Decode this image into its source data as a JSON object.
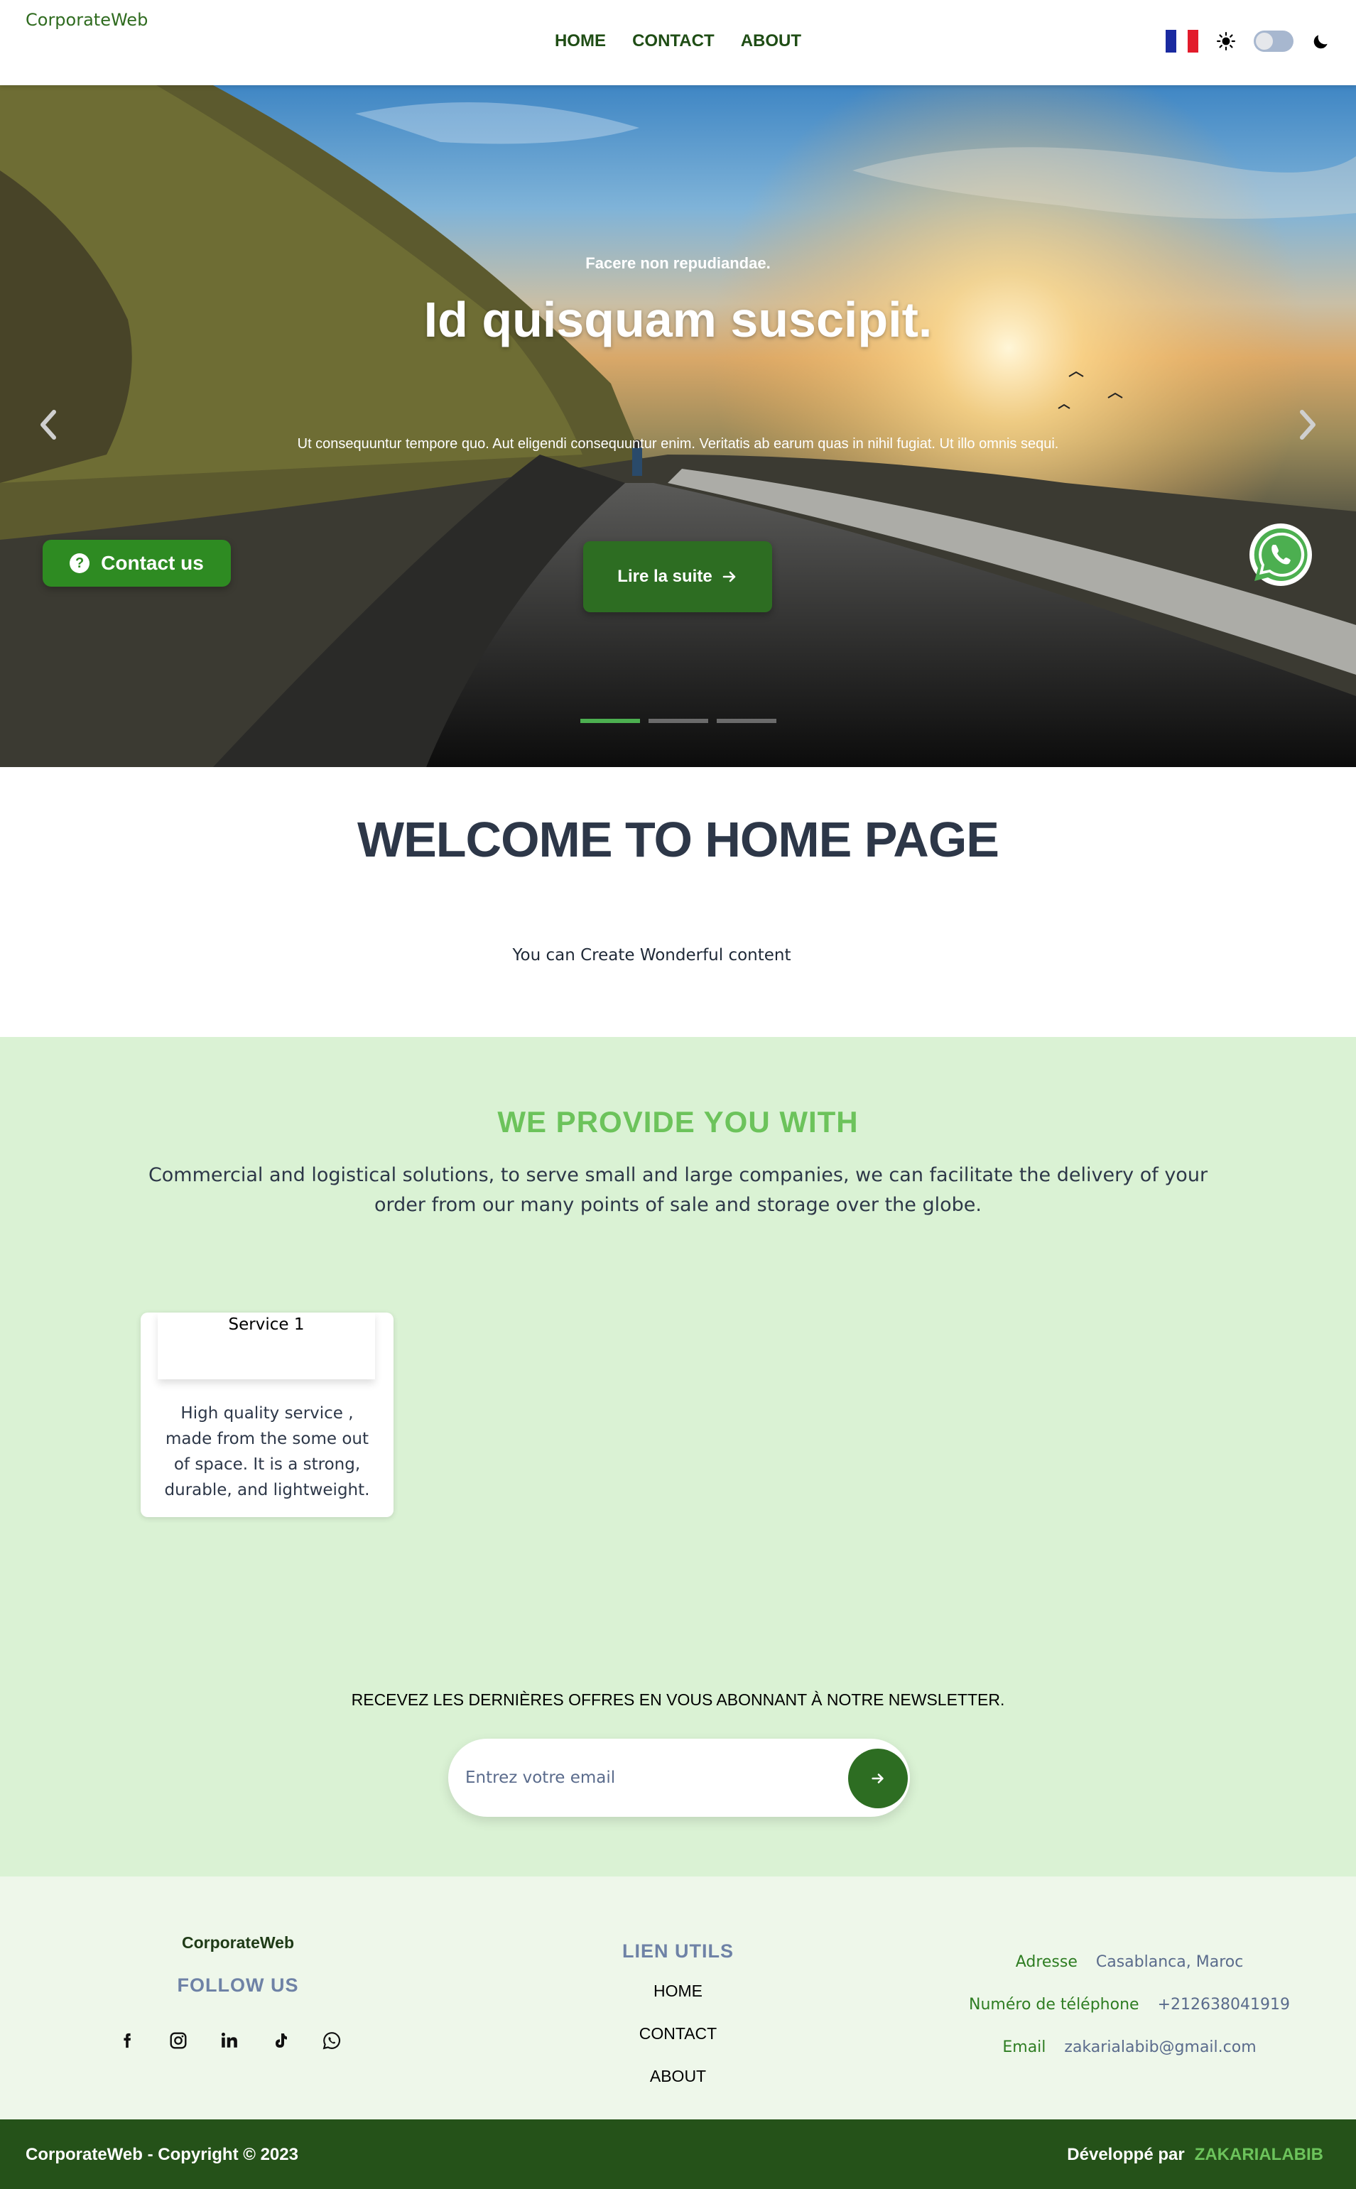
{
  "navbar": {
    "brand": "CorporateWeb",
    "links": [
      "HOME",
      "CONTACT",
      "ABOUT"
    ],
    "language_icon": "france-flag-icon",
    "theme_icons": [
      "sun-icon",
      "toggle-switch",
      "moon-icon"
    ]
  },
  "hero": {
    "eyebrow": "Facere non repudiandae.",
    "title": "Id quisquam suscipit.",
    "text": "Ut consequuntur tempore quo. Aut eligendi consequuntur enim. Veritatis ab earum quas in nihil fugiat. Ut illo omnis sequi.",
    "button_label": "Lire la suite",
    "slides_count": 3,
    "active_slide": 1
  },
  "floating": {
    "contact_label": "Contact us",
    "whatsapp_icon": "whatsapp-icon"
  },
  "welcome": {
    "title": "WELCOME TO HOME PAGE",
    "subtitle": "You can Create Wonderful content"
  },
  "provide": {
    "title": "WE PROVIDE YOU WITH",
    "text": "Commercial and logistical solutions, to serve small and large companies, we can facilitate the delivery of your order from our many points of sale and storage over the globe.",
    "services": [
      {
        "title": "Service 1",
        "description": "High quality service , made from the some out of space. It is a strong, durable, and lightweight."
      }
    ]
  },
  "newsletter": {
    "title": "RECEVEZ LES DERNIÈRES OFFRES EN VOUS ABONNANT À NOTRE NEWSLETTER.",
    "placeholder": "Entrez votre email"
  },
  "footer": {
    "brand": "CorporateWeb",
    "follow": "FOLLOW US",
    "socials": [
      "facebook-icon",
      "instagram-icon",
      "linkedin-icon",
      "tiktok-icon",
      "whatsapp-icon"
    ],
    "links_title": "LIEN UTILS",
    "links": [
      "HOME",
      "CONTACT",
      "ABOUT"
    ],
    "contact": [
      {
        "label": "Adresse",
        "value": "Casablanca, Maroc"
      },
      {
        "label": "Numéro de téléphone",
        "value": "+212638041919"
      },
      {
        "label": "Email",
        "value": "zakarialabib@gmail.com"
      }
    ],
    "copyright": "CorporateWeb - Copyright © 2023",
    "developed_by": "Développé par",
    "developer": "ZAKARIALABIB"
  },
  "colors": {
    "primary_green": "#2d6d22",
    "accent_green": "#6cc35b",
    "light_green_bg": "#daf2d4",
    "footer_bg": "#eef7ea",
    "bottom_bar": "#255219",
    "heading_dark": "#2d3748"
  }
}
